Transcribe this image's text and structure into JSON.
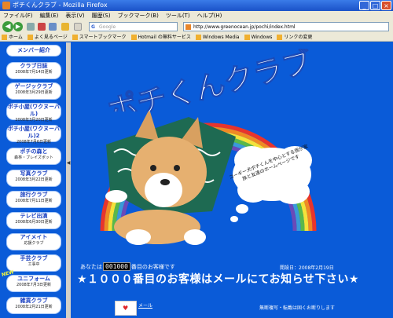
{
  "browser": {
    "window_title": "ポチくんクラブ - Mozilla Firefox",
    "menu": [
      "ファイル(F)",
      "編集(E)",
      "表示(V)",
      "履歴(S)",
      "ブックマーク(B)",
      "ツール(T)",
      "ヘルプ(H)"
    ],
    "search_placeholder": "Google",
    "url": "http://www.greenocean.jp/pochi/index.html",
    "bookmarks": [
      "ホーム",
      "よく見るページ",
      "スマートブックマーク",
      "Hotmail の無料サービス",
      "Windows Media",
      "Windows",
      "リンクの変更"
    ]
  },
  "sidebar": {
    "items": [
      {
        "label": "メンバー紹介",
        "sub": ""
      },
      {
        "label": "クラブ日誌",
        "sub": "2008年7月14日更新"
      },
      {
        "label": "ゲージックラブ",
        "sub": "2008年3月29日更新"
      },
      {
        "label": "ポチ小屋(ワクヌーバル)",
        "sub": "2008年3月20日更新"
      },
      {
        "label": "ポチ小屋(ワクヌーバル)2",
        "sub": "2008年7月6日更新"
      },
      {
        "label": "ポチの森と",
        "sub": "森林・ブレイズポット"
      },
      {
        "label": "写真クラブ",
        "sub": "2008年3月22日更新"
      },
      {
        "label": "旅行クラブ",
        "sub": "2008年7月11日更新"
      },
      {
        "label": "テレビ出演",
        "sub": "2008年6月30日更新"
      },
      {
        "label": "アイメイト",
        "sub": "応援クラブ"
      },
      {
        "label": "手芸クラブ",
        "sub": "工事中"
      },
      {
        "label": "ユニフォーム",
        "sub": "2008年7月3日更新"
      },
      {
        "label": "雑貨クラブ",
        "sub": "2008年2月21日更新"
      }
    ],
    "new_badge": "NEW"
  },
  "main": {
    "site_title": "ポチくんクラブ",
    "speech_text": "コーギー犬ポチくんを中心とする我が家族と友達のホームページです",
    "counter_prefix": "あなたは",
    "counter_value": "001000",
    "counter_suffix": "番目のお客様です",
    "opened": "開設日：2008年2月19日",
    "notice": "★１０００番目のお客様はメールにてお知らせ下さい★",
    "mail_label": "メール",
    "copyright": "無断複写・転載は固くお断りします"
  },
  "colors": {
    "background": "#0a5bd8",
    "scarf_green": "#1e6a52",
    "rainbow": [
      "#e8342c",
      "#f08a24",
      "#f4e23a",
      "#5ab84a",
      "#3a9ad8",
      "#6a4ab8"
    ]
  }
}
